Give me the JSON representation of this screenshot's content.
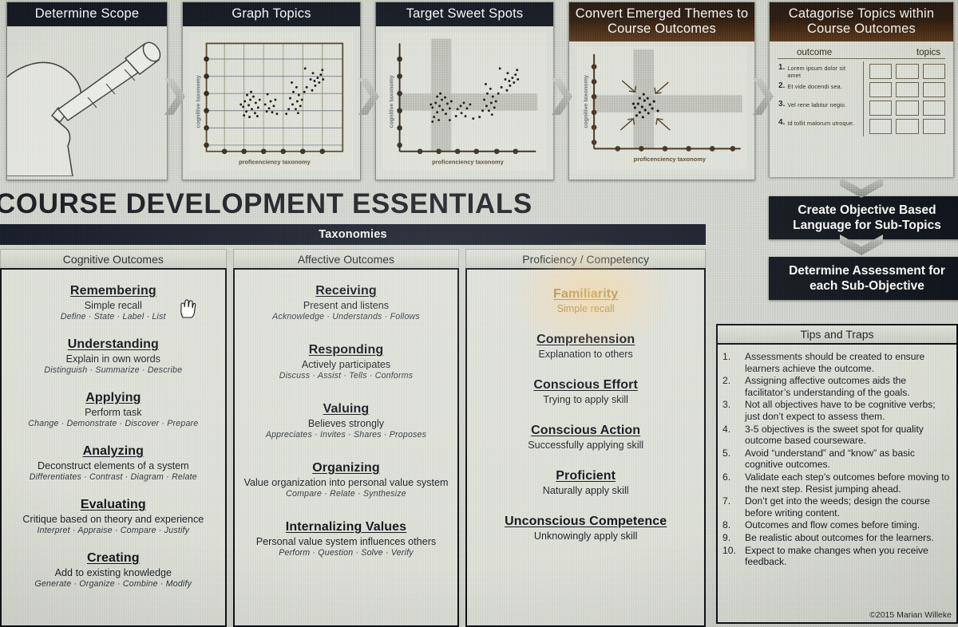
{
  "slide": {
    "main_title": "COURSE DEVELOPMENT ESSENTIALS",
    "copyright": "©2015 Marian  Willeke"
  },
  "process_steps": [
    {
      "label": "Determine Scope",
      "icon": "head-telescope-icon"
    },
    {
      "label": "Graph Topics",
      "icon": "scatter-plot-icon"
    },
    {
      "label": "Target Sweet Spots",
      "icon": "scatter-plot-crosshair-icon"
    },
    {
      "label": "Convert Emerged Themes to Course Outcomes",
      "icon": "scatter-plot-arrows-icon"
    },
    {
      "label": "Catagorise Topics within Course Outcomes",
      "icon": "outcome-topics-table-icon"
    }
  ],
  "graph_axes": {
    "x_label": "proficenciency taxonomy",
    "y_label": "cognitive taxonomy"
  },
  "categorise_card": {
    "col_outcome": "outcome",
    "col_topics": "topics",
    "rows": [
      {
        "num": "1.",
        "text": "Lorem ipsum dolor sit amet"
      },
      {
        "num": "2.",
        "text": "Et vide docendi sea."
      },
      {
        "num": "3.",
        "text": "Vel rene labitur negio."
      },
      {
        "num": "4.",
        "text": "Id tollit malorum utroque."
      }
    ]
  },
  "right_stack": [
    {
      "label": "Create Objective Based Language for Sub-Topics"
    },
    {
      "label": "Determine Assessment for each Sub-Objective"
    }
  ],
  "taxonomies": {
    "banner": "Taxonomies",
    "columns": [
      {
        "header": "Cognitive Outcomes",
        "entries": [
          {
            "title": "Remembering",
            "desc": "Simple recall",
            "verbs": "Define · State · Label · List"
          },
          {
            "title": "Understanding",
            "desc": "Explain in own words",
            "verbs": "Distinguish · Summarize · Describe"
          },
          {
            "title": "Applying",
            "desc": "Perform task",
            "verbs": "Change · Demonstrate · Discover · Prepare"
          },
          {
            "title": "Analyzing",
            "desc": "Deconstruct elements of a system",
            "verbs": "Differentiates · Contrast · Diagram · Relate"
          },
          {
            "title": "Evaluating",
            "desc": "Critique based on theory and experience",
            "verbs": "Interpret · Appraise · Compare · Justify"
          },
          {
            "title": "Creating",
            "desc": "Add to existing knowledge",
            "verbs": "Generate · Organize · Combine · Modify"
          }
        ]
      },
      {
        "header": "Affective Outcomes",
        "entries": [
          {
            "title": "Receiving",
            "desc": "Present and listens",
            "verbs": "Acknowledge · Understands · Follows"
          },
          {
            "title": "Responding",
            "desc": "Actively participates",
            "verbs": "Discuss · Assist · Tells · Conforms"
          },
          {
            "title": "Valuing",
            "desc": "Believes strongly",
            "verbs": "Appreciates · Invites · Shares · Proposes"
          },
          {
            "title": "Organizing",
            "desc": "Value organization into personal value system",
            "verbs": "Compare · Relate · Synthesize"
          },
          {
            "title": "Internalizing Values",
            "desc": "Personal value system influences others",
            "verbs": "Perform · Question · Solve · Verify"
          }
        ]
      },
      {
        "header": "Proficiency / Competency",
        "entries": [
          {
            "title": "Familiarity",
            "desc": "Simple recall",
            "verbs": ""
          },
          {
            "title": "Comprehension",
            "desc": "Explanation to others",
            "verbs": ""
          },
          {
            "title": "Conscious Effort",
            "desc": "Trying to apply skill",
            "verbs": ""
          },
          {
            "title": "Conscious Action",
            "desc": "Successfully applying skill",
            "verbs": ""
          },
          {
            "title": "Proficient",
            "desc": "Naturally apply skill",
            "verbs": ""
          },
          {
            "title": "Unconscious Competence",
            "desc": "Unknowingly apply skill",
            "verbs": ""
          }
        ]
      }
    ]
  },
  "tips": {
    "header": "Tips and Traps",
    "items": [
      "Assessments should be created to ensure learners achieve the outcome.",
      "Assigning affective outcomes aids the facilitator’s understanding of the goals.",
      "Not all objectives have to be cognitive verbs; just don’t expect to assess them.",
      "3-5 objectives is the sweet spot for quality outcome based courseware.",
      "Avoid “understand” and “know” as basic cognitive outcomes.",
      "Validate each step’s outcomes before moving to the next step. Resist jumping ahead.",
      "Don’t get into the weeds; design the course before writing content.",
      "Outcomes and flow comes before timing.",
      "Be realistic about outcomes for the learners.",
      "Expect to make changes when you receive feedback."
    ]
  },
  "colors": {
    "dark_header": "#121722",
    "warm_header": "#55341b",
    "panel_bg": "#d6d8cf",
    "gold_text": "#8a6b2c"
  }
}
